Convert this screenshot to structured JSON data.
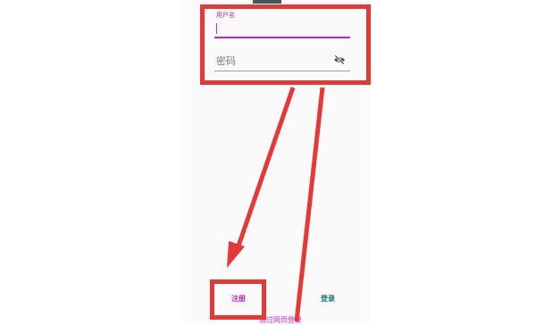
{
  "form": {
    "username_label": "用户名",
    "password_label": "密码",
    "password_toggle_icon": "eye-off-icon"
  },
  "actions": {
    "register_label": "注册",
    "login_label": "登录",
    "partial_link_text": "通过网页登录"
  },
  "colors": {
    "accent": "#c026d3",
    "login": "#17766f",
    "annotation": "#e53935",
    "screen_bg": "#fafafa"
  }
}
